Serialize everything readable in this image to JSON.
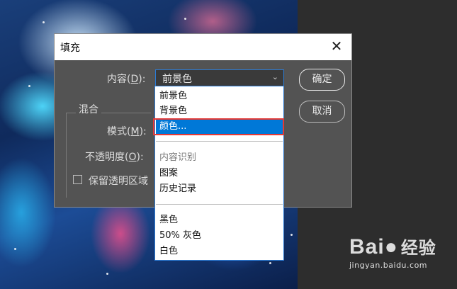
{
  "dialog": {
    "title": "填充",
    "contents_label": "内容(",
    "contents_key": "D",
    "contents_label_end": "):",
    "selected_value": "前景色",
    "ok_label": "确定",
    "cancel_label": "取消",
    "blending_group_label": "混合",
    "mode_label": "模式(",
    "mode_key": "M",
    "mode_label_end": "):",
    "opacity_label": "不透明度(",
    "opacity_key": "O",
    "opacity_label_end": "):",
    "preserve_label": "保留透明区域",
    "preserve_checked": false
  },
  "dropdown": {
    "options": [
      {
        "label": "前景色",
        "state": "normal"
      },
      {
        "label": "背景色",
        "state": "normal"
      },
      {
        "label": "颜色...",
        "state": "selected"
      },
      {
        "label": "内容识别",
        "state": "disabled"
      },
      {
        "label": "图案",
        "state": "normal"
      },
      {
        "label": "历史记录",
        "state": "normal"
      },
      {
        "label": "黑色",
        "state": "normal"
      },
      {
        "label": "50% 灰色",
        "state": "normal"
      },
      {
        "label": "白色",
        "state": "normal"
      }
    ]
  },
  "watermark": {
    "logo": "Bai",
    "logo_cn": "经验",
    "url": "jingyan.baidu.com"
  },
  "colors": {
    "dialog_bg": "#535353",
    "selection": "#0078d7",
    "highlight": "#e53935"
  }
}
